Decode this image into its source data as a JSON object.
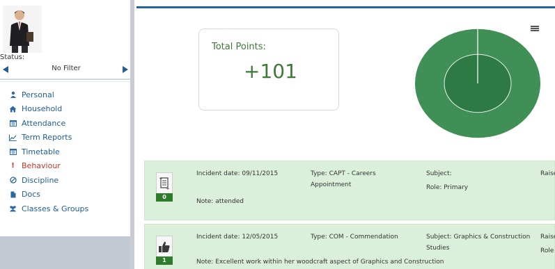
{
  "sidebar": {
    "status_label": "Status:",
    "filter_text": "No Filter",
    "nav": [
      {
        "label": "Personal",
        "icon": "person-icon"
      },
      {
        "label": "Household",
        "icon": "home-icon"
      },
      {
        "label": "Attendance",
        "icon": "calendar-icon"
      },
      {
        "label": "Term Reports",
        "icon": "line-chart-icon"
      },
      {
        "label": "Timetable",
        "icon": "calendar-icon"
      },
      {
        "label": "Behaviour",
        "icon": "exclamation-icon"
      },
      {
        "label": "Discipline",
        "icon": "ban-icon"
      },
      {
        "label": "Docs",
        "icon": "document-icon"
      },
      {
        "label": "Classes & Groups",
        "icon": "users-icon"
      }
    ]
  },
  "summary": {
    "title": "Total Points:",
    "value": "+101"
  },
  "chart_data": {
    "type": "pie",
    "values": [
      101
    ],
    "colors": [
      "#3f8f56",
      "#2d7a44"
    ]
  },
  "incidents": [
    {
      "date": "Incident date: 09/11/2015",
      "type": "Type: CAPT - Careers Appointment",
      "subject": "Subject:",
      "role": "Role: Primary",
      "raised": "Raise",
      "note": "Note: attended",
      "points": "0",
      "icon": "certificate-icon"
    },
    {
      "date": "Incident date: 12/05/2015",
      "type": "Type: COM - Commendation",
      "subject": "Subject: Graphics & Construction Studies",
      "role": "Role",
      "raised": "Raise",
      "note": "Note: Excellent work within her woodcraft aspect of Graphics and Construction",
      "points": "1",
      "icon": "thumbs-up-icon"
    }
  ],
  "colors": {
    "accent": "#2563a5",
    "nav_link": "#1f5d95",
    "behaviour": "#c0392b",
    "points_text": "#3e7a37",
    "incident_bg": "#dbf0da",
    "badge_green": "#2f7d2c"
  }
}
